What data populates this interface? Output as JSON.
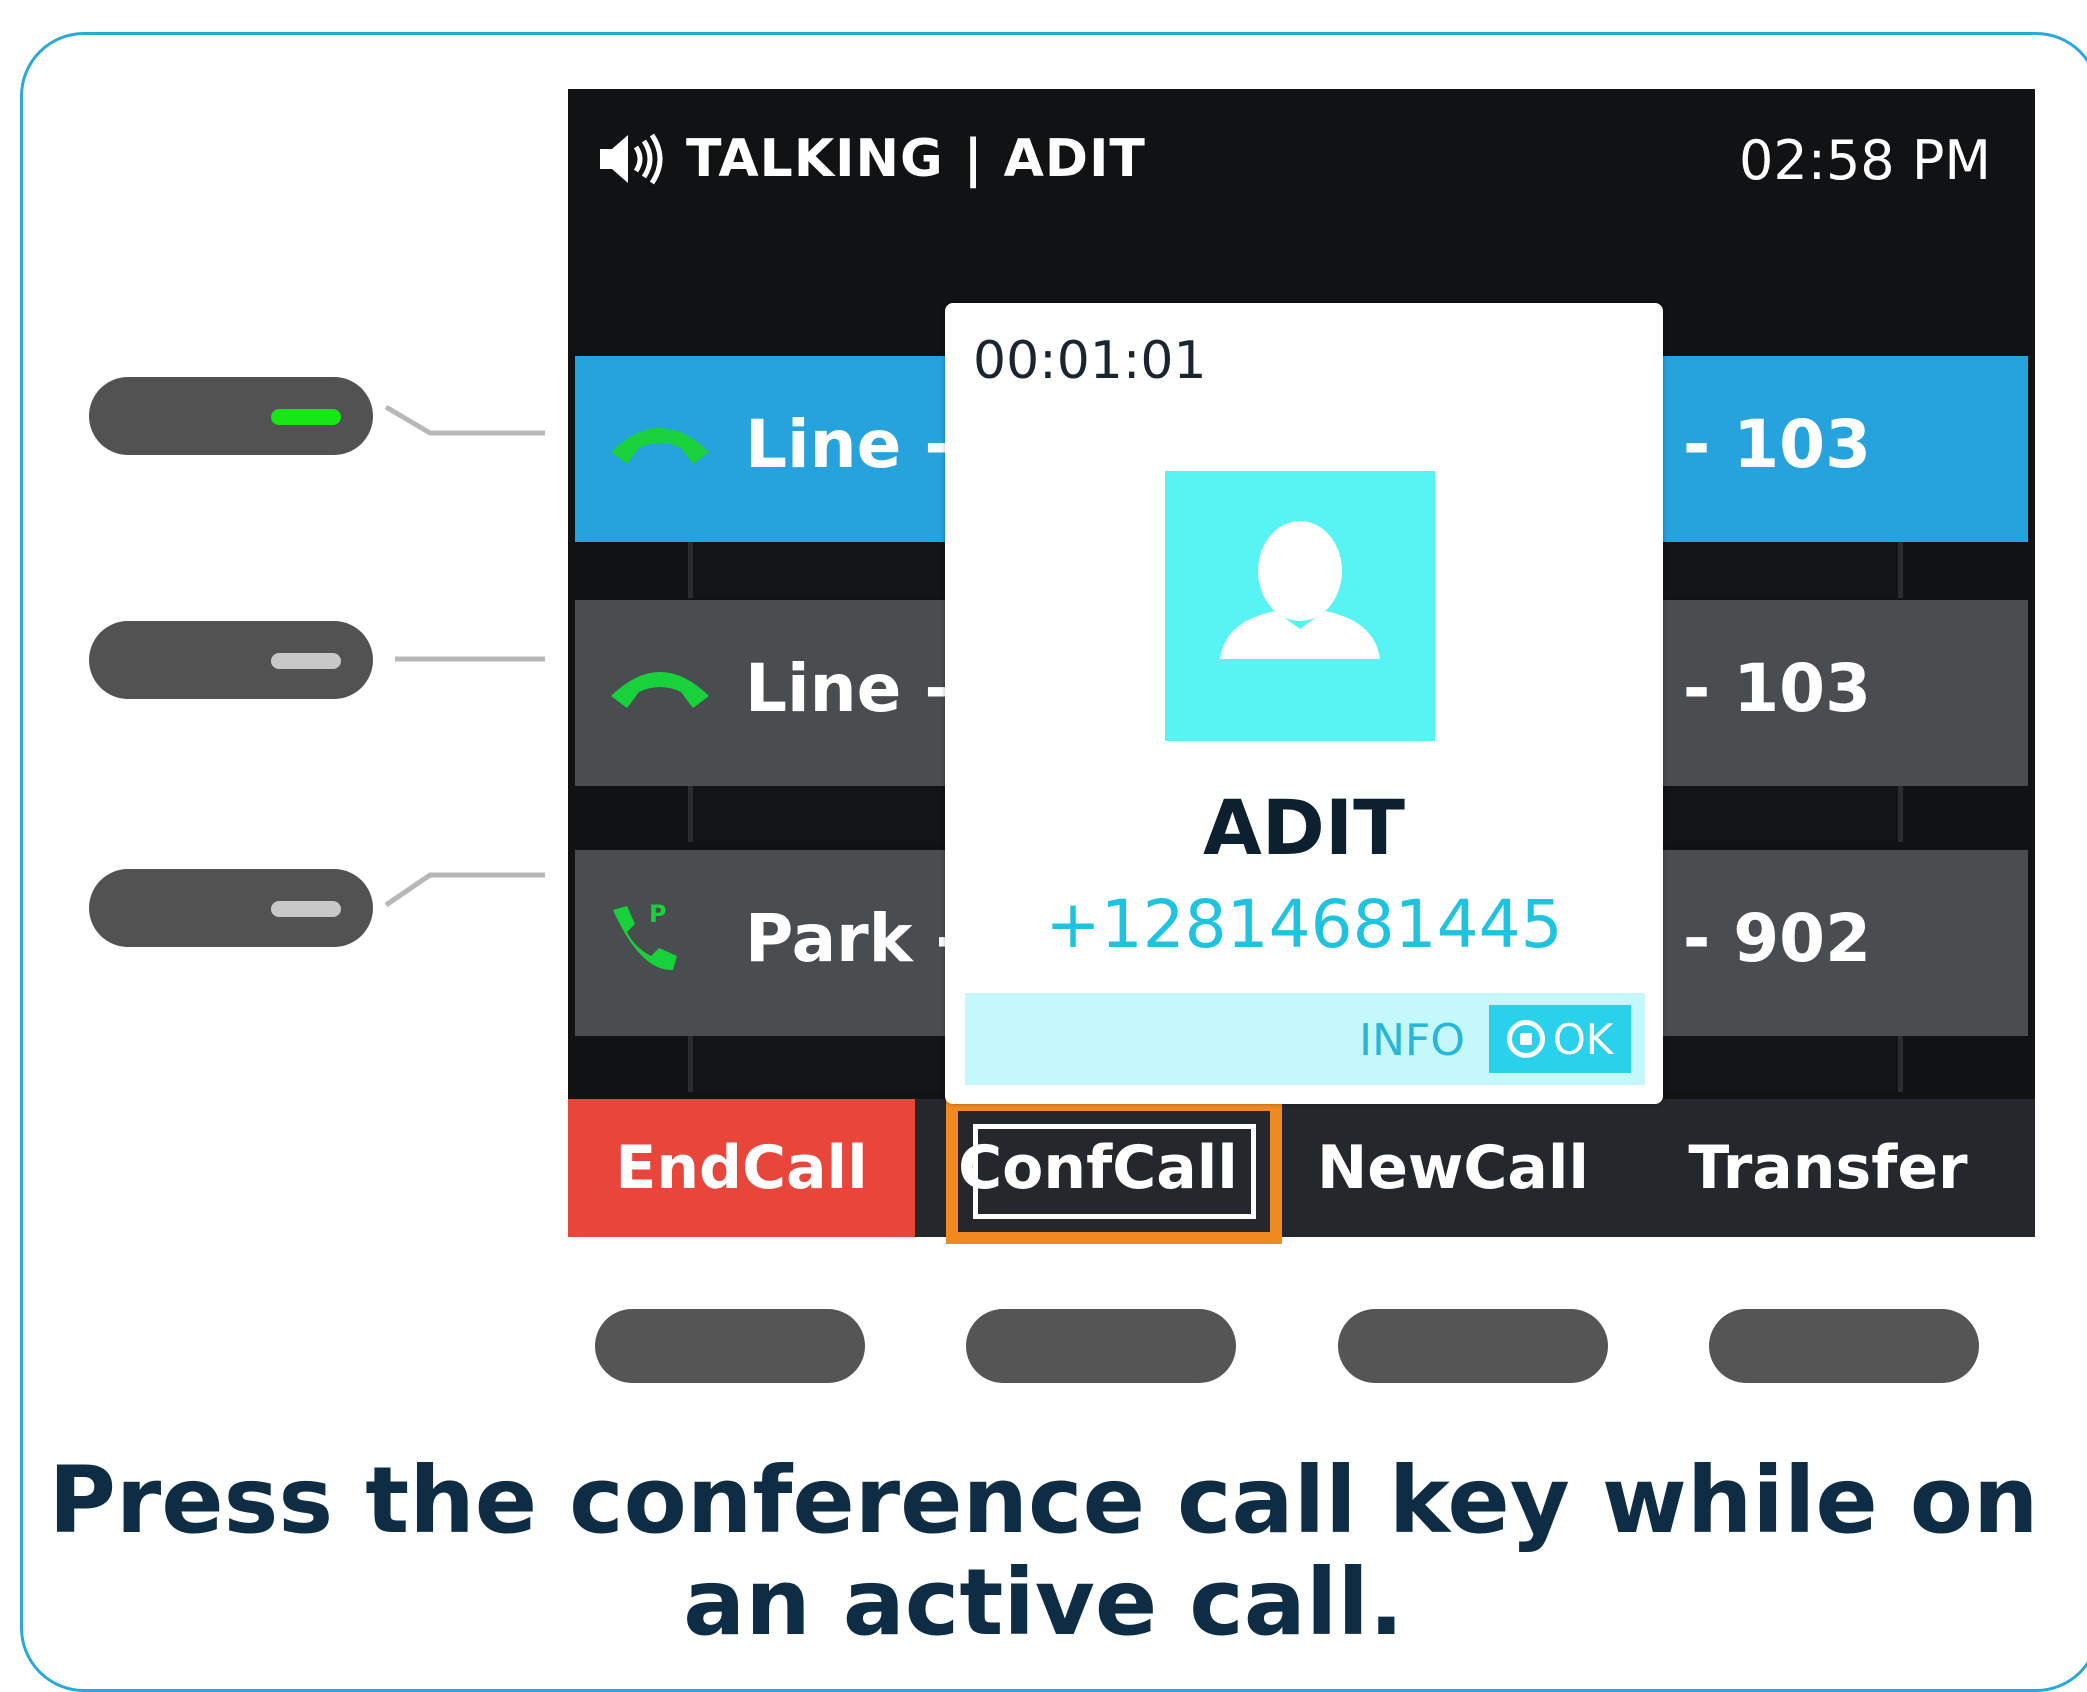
{
  "status": {
    "state": "TALKING",
    "separator": "|",
    "contact": "ADIT",
    "time": "02:58 PM"
  },
  "lines": [
    {
      "left_label": "Line -",
      "right_label": "e - 103",
      "icon": "phone-handset-icon",
      "active": true
    },
    {
      "left_label": "Line -",
      "right_label": "e - 103",
      "icon": "phone-handset-icon",
      "active": false
    },
    {
      "left_label": "Park -",
      "right_label": "k - 902",
      "icon": "park-call-icon",
      "active": false
    }
  ],
  "popup": {
    "timer": "00:01:01",
    "name": "ADIT",
    "number": "+12814681445",
    "info_label": "INFO",
    "ok_label": "OK",
    "avatar_icon": "person-avatar-icon"
  },
  "softkeys": {
    "end_call": "EndCall",
    "conf_call": "ConfCall",
    "new_call": "NewCall",
    "transfer": "Transfer"
  },
  "colors": {
    "frame_border": "#29a9d9",
    "active_line": "#26a3dd",
    "end_call": "#e8453b",
    "highlight": "#f0891f",
    "led_on": "#17e617",
    "avatar_bg": "#58f3f3",
    "number_text": "#1ec4df"
  },
  "caption": {
    "line1": "Press the conference call key while on",
    "line2": "an active call."
  }
}
